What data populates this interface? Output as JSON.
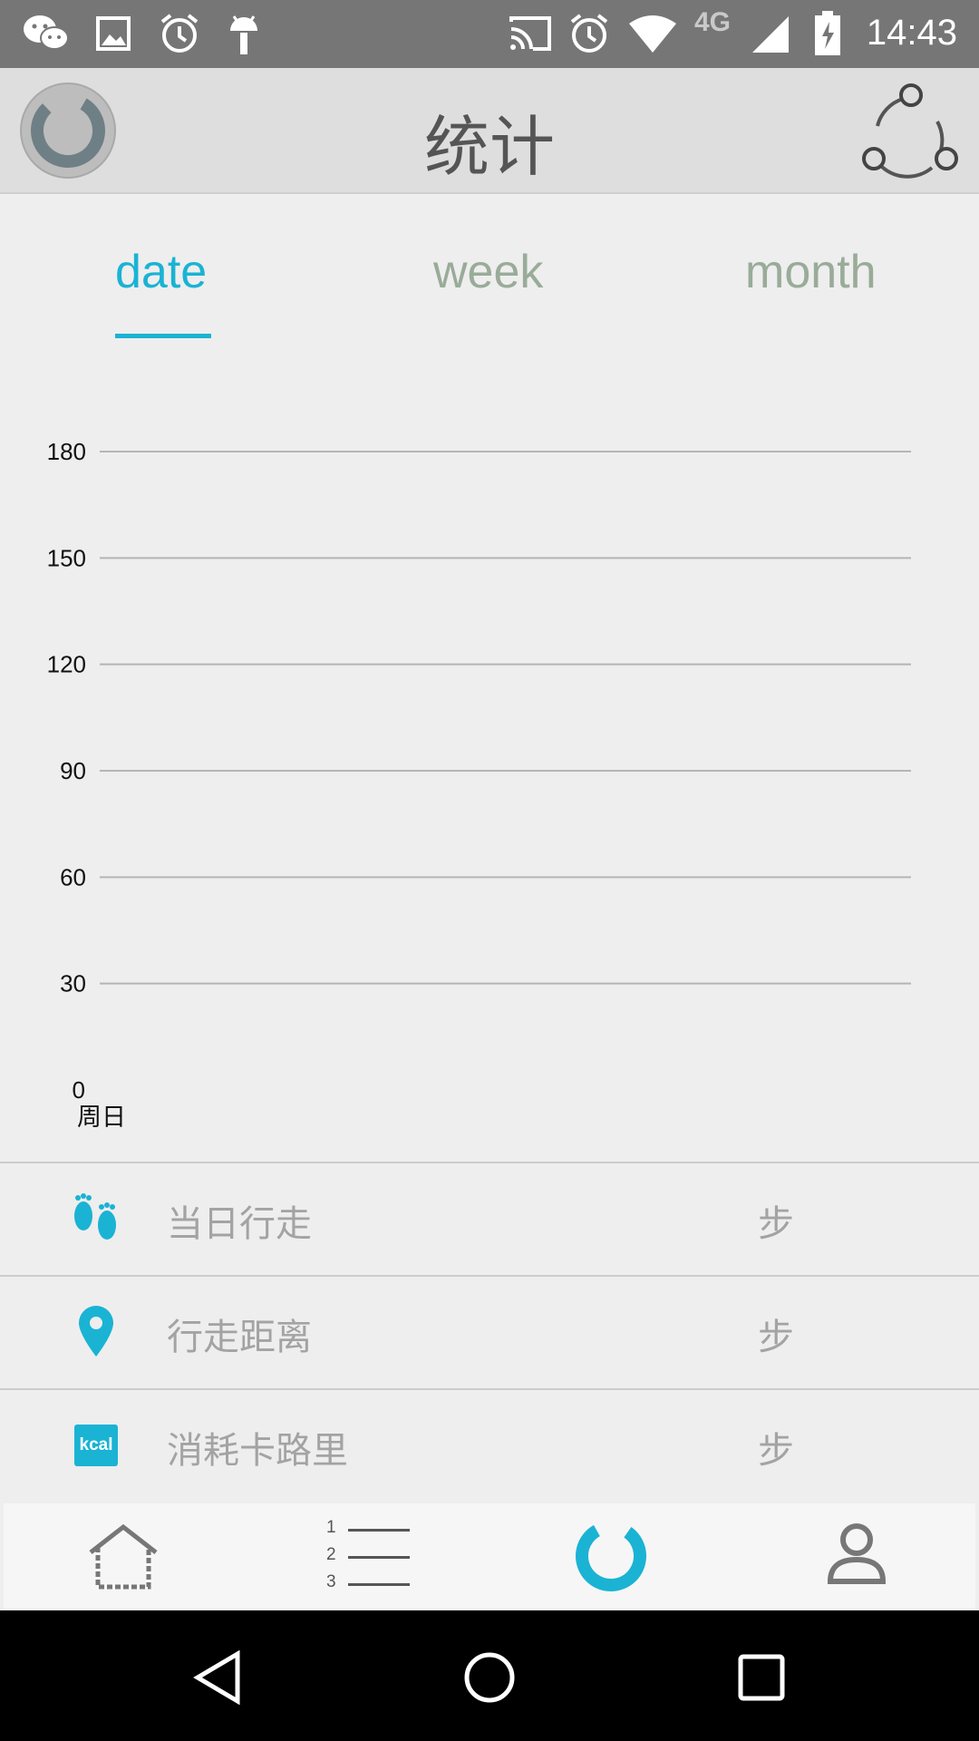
{
  "status_bar": {
    "time": "14:43",
    "network_label": "4G",
    "icons": [
      "wechat-icon",
      "image-icon",
      "alarm-icon",
      "android-icon",
      "cast-icon",
      "alarm-icon",
      "wifi-icon",
      "signal-icon",
      "battery-charging-icon"
    ]
  },
  "app_bar": {
    "title": "统计",
    "left_icon": "ring-logo-icon",
    "right_icon": "share-icon"
  },
  "tabs": [
    {
      "label": "date",
      "active": true
    },
    {
      "label": "week",
      "active": false
    },
    {
      "label": "month",
      "active": false
    }
  ],
  "chart_data": {
    "type": "bar",
    "categories": [
      "周日"
    ],
    "values": [
      0
    ],
    "title": "",
    "xlabel": "",
    "ylabel": "",
    "ylim": [
      0,
      180
    ],
    "yticks": [
      180,
      150,
      120,
      90,
      60,
      30,
      0
    ],
    "grid": true
  },
  "stats": [
    {
      "icon": "footprints-icon",
      "label": "当日行走",
      "unit": "步"
    },
    {
      "icon": "location-pin-icon",
      "label": "行走距离",
      "unit": "步"
    },
    {
      "icon": "kcal-icon",
      "icon_text": "kcal",
      "label": "消耗卡路里",
      "unit": "步"
    }
  ],
  "bottom_nav": [
    {
      "icon": "home-icon",
      "active": false
    },
    {
      "icon": "ranked-list-icon",
      "active": false,
      "numbers": [
        "1",
        "2",
        "3"
      ]
    },
    {
      "icon": "statistics-ring-icon",
      "active": true
    },
    {
      "icon": "profile-icon",
      "active": false
    }
  ],
  "colors": {
    "accent": "#1ab3d4",
    "inactive_tab": "#99ab99",
    "status_bar": "#767676",
    "app_bar": "#dedede"
  }
}
